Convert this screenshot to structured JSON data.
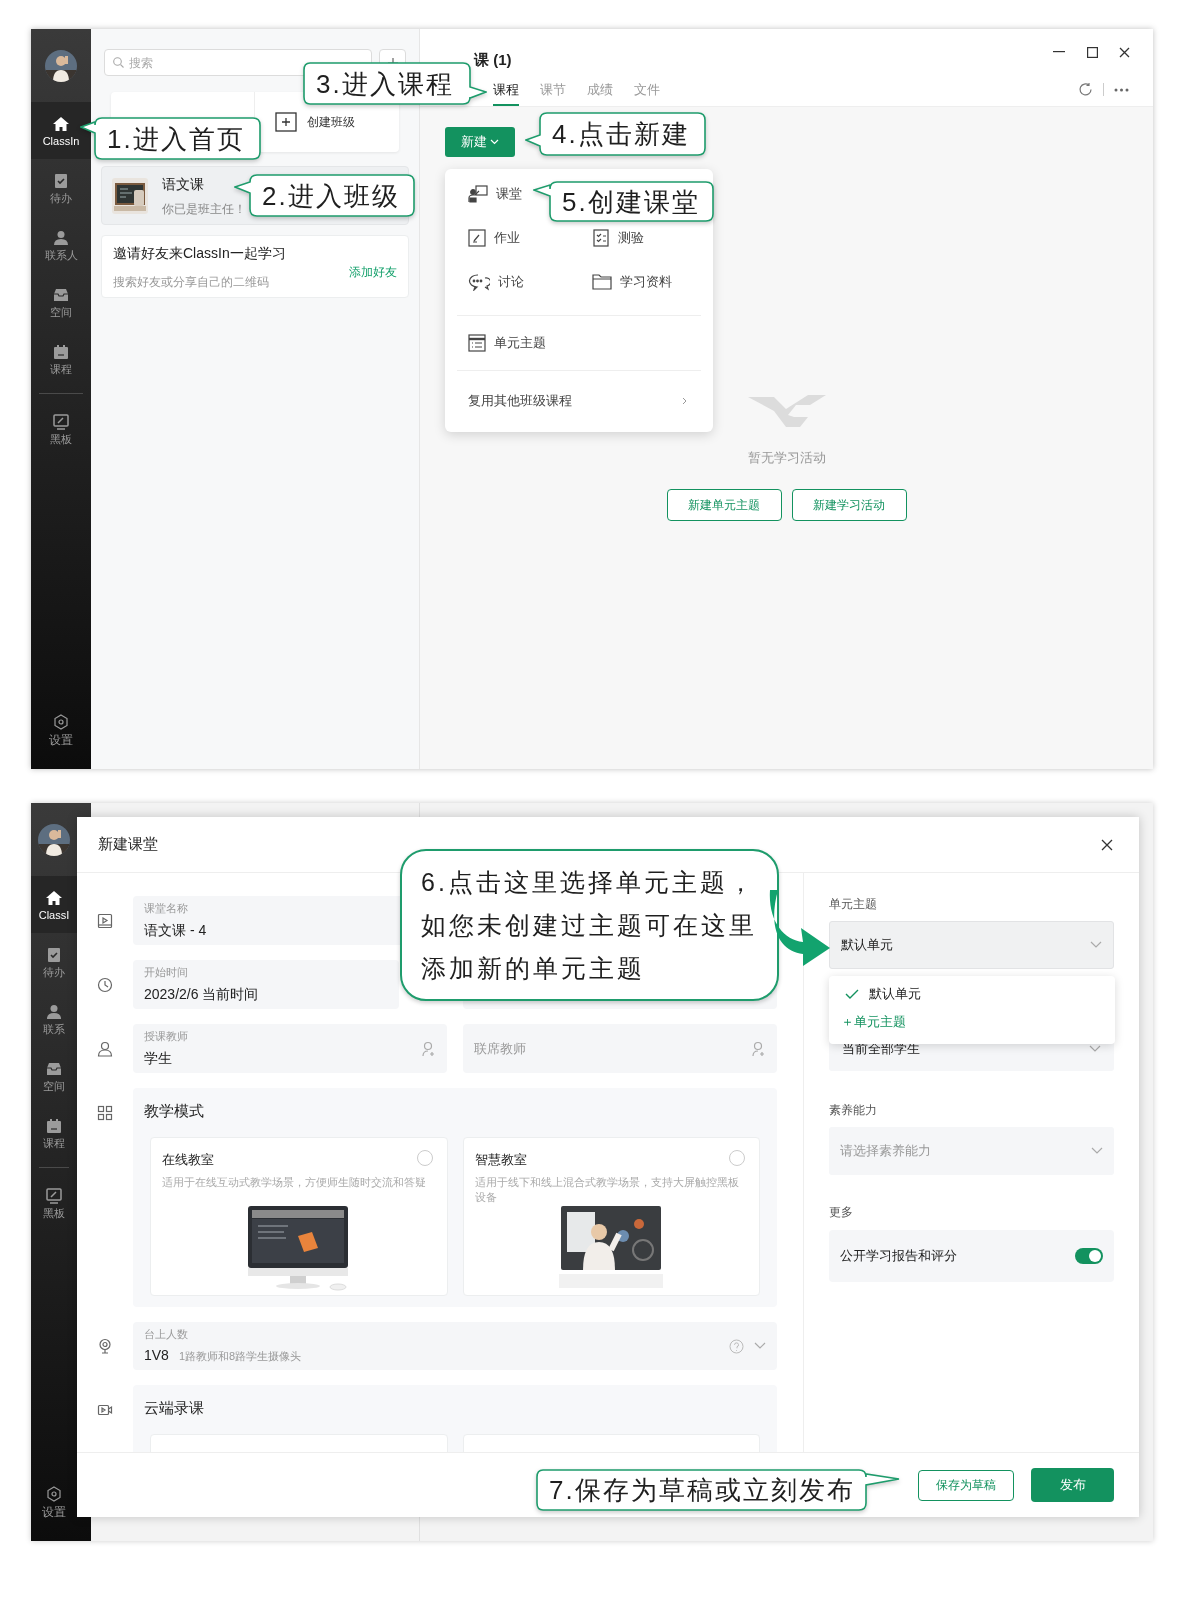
{
  "home_window": {
    "sidebar": {
      "items": [
        {
          "label": "ClassIn",
          "selected": true
        },
        {
          "label": "待办",
          "selected": false
        },
        {
          "label": "联系人",
          "selected": false
        },
        {
          "label": "空间",
          "selected": false
        },
        {
          "label": "课程",
          "selected": false
        },
        {
          "label": "黑板",
          "selected": false
        }
      ],
      "settings": "设置"
    },
    "search": {
      "placeholder": "搜索"
    },
    "create_class": "创建班级",
    "classes": [
      {
        "name": "语文课",
        "subtitle": "你已是班主任！",
        "selected": true
      }
    ],
    "invite": {
      "title": "邀请好友来ClassIn一起学习",
      "subtitle": "搜索好友或分享自己的二维码",
      "action": "添加好友"
    },
    "course": {
      "title": "课 (1)",
      "tabs": [
        {
          "label": "课程",
          "selected": true
        },
        {
          "label": "课节",
          "selected": false
        },
        {
          "label": "成绩",
          "selected": false
        },
        {
          "label": "文件",
          "selected": false
        }
      ],
      "new_button": "新建",
      "menu": {
        "items": [
          {
            "label": "课堂"
          },
          {
            "label": "作业"
          },
          {
            "label": "测验"
          },
          {
            "label": "讨论"
          },
          {
            "label": "学习资料"
          }
        ],
        "unit_item": "单元主题",
        "reuse_item": "复用其他班级课程"
      },
      "empty_text": "暂无学习活动",
      "actions": [
        "新建单元主题",
        "新建学习活动"
      ]
    },
    "callouts": [
      "1.进入首页",
      "2.进入班级",
      "3.进入课程",
      "4.点击新建",
      "5.创建课堂"
    ]
  },
  "lesson_dialog": {
    "sidebar": {
      "items": [
        {
          "label": "ClassI",
          "selected": true
        },
        {
          "label": "待办",
          "selected": false
        },
        {
          "label": "联系",
          "selected": false
        },
        {
          "label": "空间",
          "selected": false
        },
        {
          "label": "课程",
          "selected": false
        },
        {
          "label": "黑板",
          "selected": false
        }
      ],
      "settings": "设置"
    },
    "title": "新建课堂",
    "name_field": {
      "label": "课堂名称",
      "value": "语文课 - 4"
    },
    "time_field": {
      "label": "开始时间",
      "value": "2023/2/6 当前时间"
    },
    "teacher_field": {
      "label": "授课教师",
      "value": "学生"
    },
    "co_teacher_field": {
      "placeholder": "联席教师"
    },
    "mode": {
      "title": "教学模式",
      "options": [
        {
          "title": "在线教室",
          "description": "适用于在线互动式教学场景，方便师生随时交流和答疑",
          "selected": false
        },
        {
          "title": "智慧教室",
          "description": "适用于线下和线上混合式教学场景，支持大屏触控黑板设备",
          "selected": false
        }
      ]
    },
    "stage": {
      "label": "台上人数",
      "value": "1V8",
      "note": "1路教师和8路学生摄像头"
    },
    "recording": {
      "title": "云端录课"
    },
    "unit": {
      "label": "单元主题",
      "value": "默认单元",
      "options": [
        {
          "label": "默认单元",
          "selected": true
        }
      ],
      "add_action": "＋单元主题"
    },
    "students": {
      "value": "当前全部学生"
    },
    "literacy": {
      "label": "素养能力",
      "placeholder": "请选择素养能力"
    },
    "more": {
      "label": "更多",
      "toggle": {
        "label": "公开学习报告和评分",
        "on": true
      }
    },
    "buttons": {
      "draft": "保存为草稿",
      "publish": "发布"
    },
    "hint_callout": {
      "lines": [
        "6.点击这里选择单元主题，",
        "如您未创建过主题可在这里",
        "添加新的单元主题"
      ]
    },
    "save_callout": "7.保存为草稿或立刻发布"
  }
}
